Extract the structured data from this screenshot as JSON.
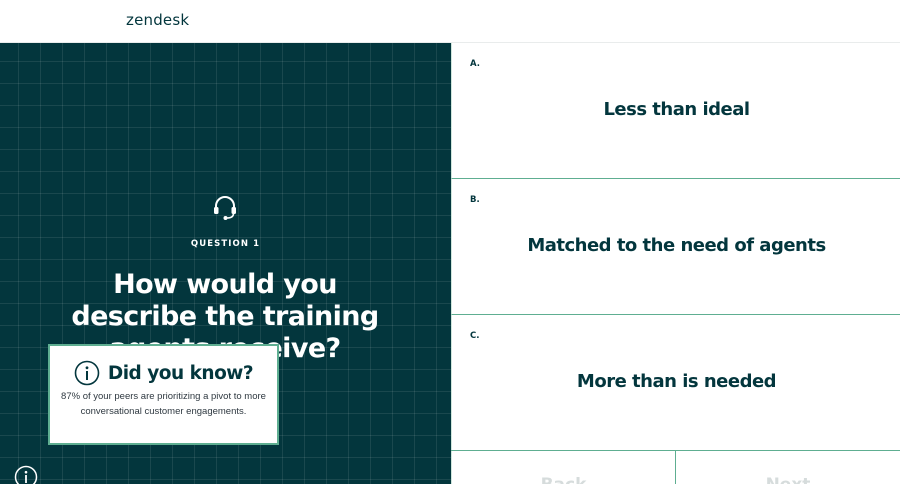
{
  "header": {
    "logo": "zendesk"
  },
  "question": {
    "label": "QUESTION 1",
    "text": "How would you describe the training agents receive?",
    "icon": "headset-icon"
  },
  "did_you_know": {
    "title": "Did you know?",
    "text": "87% of your peers are prioritizing a pivot to more conversational customer engagements.",
    "icon": "info-icon"
  },
  "answers": [
    {
      "letter": "A.",
      "text": "Less than ideal"
    },
    {
      "letter": "B.",
      "text": "Matched to the need of agents"
    },
    {
      "letter": "C.",
      "text": "More than is needed"
    }
  ],
  "nav": {
    "back": "Back",
    "next": "Next"
  },
  "colors": {
    "panel": "#03363d",
    "accent": "#5eae91",
    "text": "#03363d"
  }
}
